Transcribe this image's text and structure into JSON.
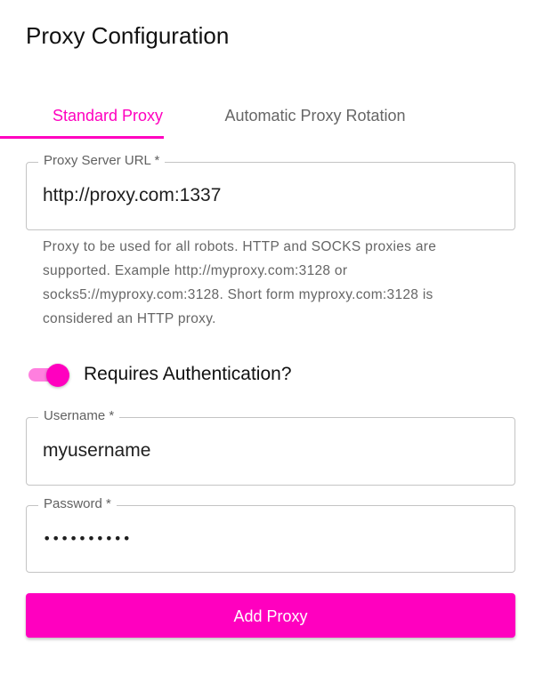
{
  "header": {
    "title": "Proxy Configuration"
  },
  "tabs": [
    {
      "label": "Standard Proxy",
      "active": true
    },
    {
      "label": "Automatic Proxy Rotation",
      "active": false
    }
  ],
  "proxy_url": {
    "label": "Proxy Server URL *",
    "value": "http://proxy.com:1337",
    "helper": "Proxy to be used for all robots. HTTP and SOCKS proxies are supported. Example http://myproxy.com:3128 or socks5://myproxy.com:3128. Short form myproxy.com:3128 is considered an HTTP proxy."
  },
  "auth_toggle": {
    "label": "Requires Authentication?",
    "checked": true
  },
  "username": {
    "label": "Username *",
    "value": "myusername"
  },
  "password": {
    "label": "Password *",
    "value": "••••••••••"
  },
  "submit": {
    "label": "Add Proxy"
  },
  "colors": {
    "accent": "#ff00bf",
    "accent_light": "#ff7fdf",
    "border": "#c4c4c4",
    "muted_text": "#666666"
  }
}
